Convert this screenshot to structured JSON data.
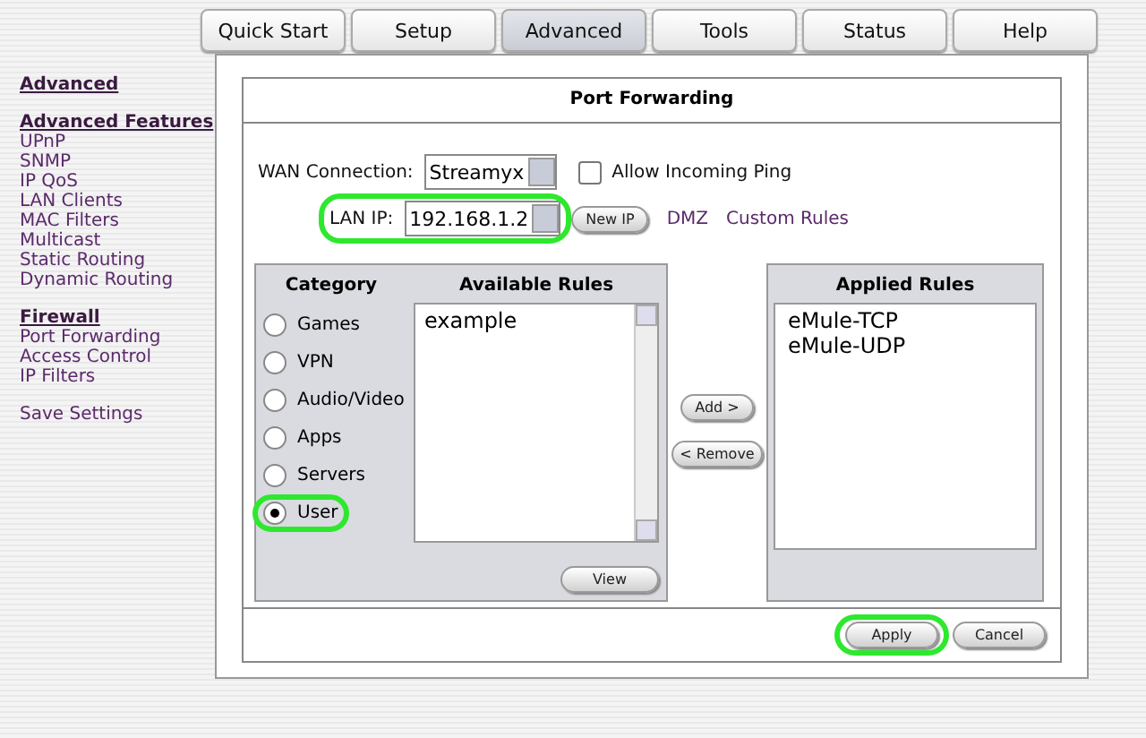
{
  "tabs": [
    {
      "label": "Quick Start",
      "selected": false
    },
    {
      "label": "Setup",
      "selected": false
    },
    {
      "label": "Advanced",
      "selected": true
    },
    {
      "label": "Tools",
      "selected": false
    },
    {
      "label": "Status",
      "selected": false
    },
    {
      "label": "Help",
      "selected": false
    }
  ],
  "sidebar": {
    "groups": [
      {
        "heading": "Advanced"
      },
      {
        "heading": "Advanced Features",
        "items": [
          "UPnP",
          "SNMP",
          "IP QoS",
          "LAN Clients",
          "MAC Filters",
          "Multicast",
          "Static Routing",
          "Dynamic Routing"
        ]
      },
      {
        "heading": "Firewall",
        "items": [
          "Port Forwarding",
          "Access Control",
          "IP Filters"
        ]
      },
      {
        "items": [
          "Save Settings"
        ]
      }
    ]
  },
  "panel": {
    "title": "Port Forwarding",
    "wan": {
      "label": "WAN Connection:",
      "value": "Streamyx",
      "ping_label": "Allow Incoming Ping",
      "ping_checked": false
    },
    "lan": {
      "label": "LAN IP:",
      "value": "192.168.1.2",
      "highlighted": true,
      "button": "New IP",
      "links": [
        "DMZ",
        "Custom Rules"
      ]
    },
    "categories": {
      "heading": "Category",
      "options": [
        {
          "label": "Games",
          "selected": false,
          "highlighted": false
        },
        {
          "label": "VPN",
          "selected": false,
          "highlighted": false
        },
        {
          "label": "Audio/Video",
          "selected": false,
          "highlighted": false
        },
        {
          "label": "Apps",
          "selected": false,
          "highlighted": false
        },
        {
          "label": "Servers",
          "selected": false,
          "highlighted": false
        },
        {
          "label": "User",
          "selected": true,
          "highlighted": true
        }
      ]
    },
    "available_rules": {
      "heading": "Available Rules",
      "items": [
        "example"
      ],
      "button": "View"
    },
    "add_button": "Add >",
    "remove_button": "< Remove",
    "applied_rules": {
      "heading": "Applied Rules",
      "items": [
        "eMule-TCP",
        "eMule-UDP"
      ]
    },
    "actions": [
      {
        "label": "Apply",
        "highlighted": true
      },
      {
        "label": "Cancel",
        "highlighted": false
      }
    ]
  }
}
